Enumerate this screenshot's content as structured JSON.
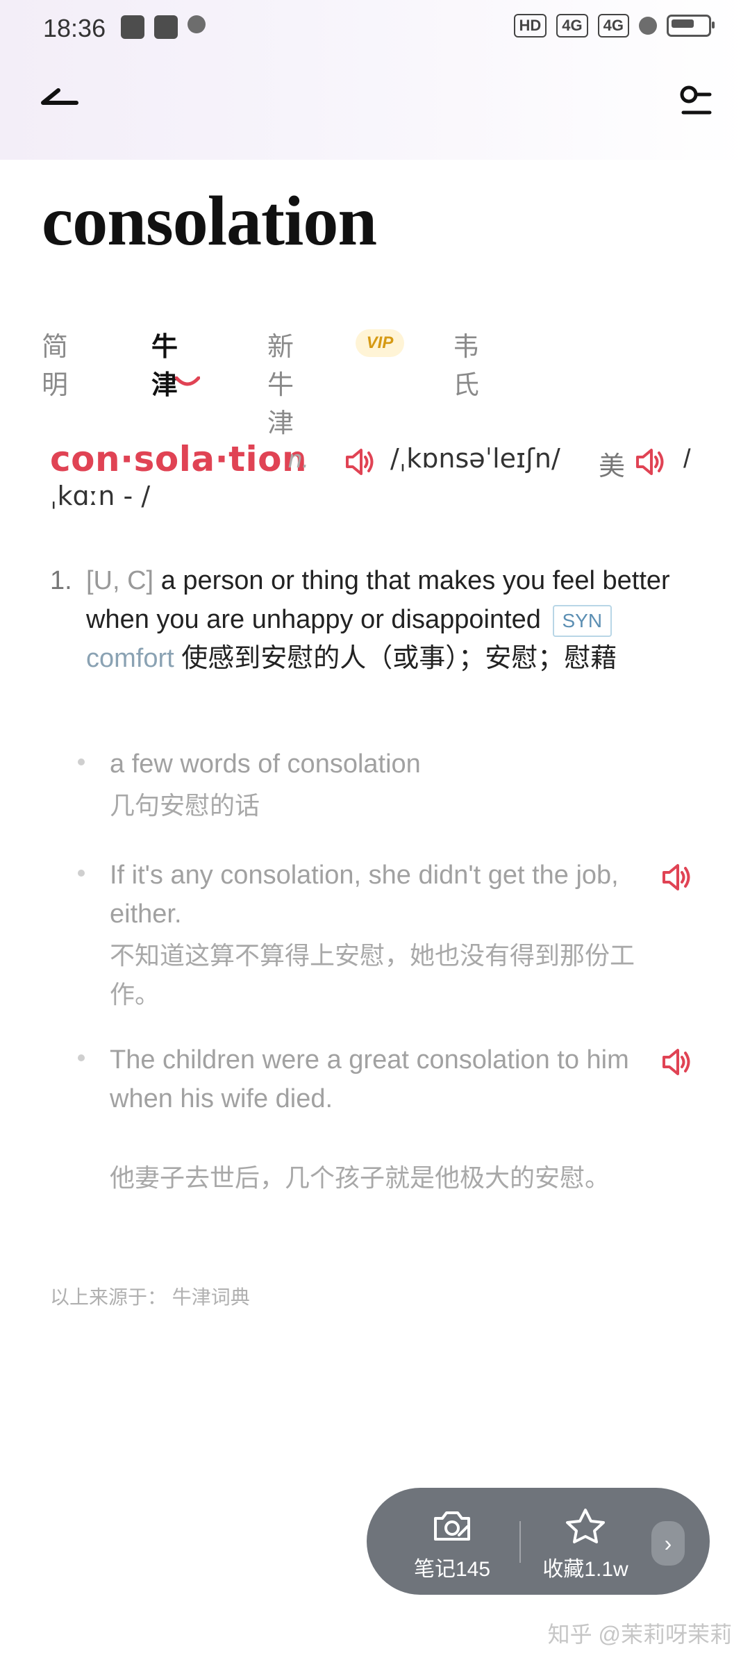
{
  "status": {
    "time": "18:36",
    "left_icons": [
      "image-app-icon",
      "chat-app-icon",
      "location-icon"
    ],
    "right_icons": [
      "hd-icon",
      "4g-signal-icon",
      "4g-signal-icon",
      "wifi-icon",
      "battery-icon"
    ]
  },
  "header": {
    "back_label": "",
    "settings_label": ""
  },
  "word": "consolation",
  "tabs": [
    {
      "label": "简明"
    },
    {
      "label": "牛津"
    },
    {
      "label": "新牛津"
    },
    {
      "label": "韦氏"
    }
  ],
  "vip_badge": "VIP",
  "entry": {
    "syllables": "con·sola·tion",
    "pos": "n.",
    "pron_uk": "/ˌkɒnsəˈleɪʃn/",
    "us_label": "美",
    "us_slash": "/",
    "pron_us": "ˌkɑːn - /"
  },
  "definition": {
    "number": "1.",
    "grammar": "[U, C]",
    "text": "a person or thing that makes you feel better when you are unhappy or disappointed",
    "syn_label": "SYN",
    "syn_word": "comfort",
    "chinese": "使感到安慰的人（或事）；安慰；慰藉"
  },
  "examples": [
    {
      "en": "a few words of consolation",
      "cn": "几句安慰的话",
      "has_audio": false
    },
    {
      "en": "If it's any consolation, she didn't get the job, either.",
      "cn": "不知道这算不算得上安慰，她也没有得到那份工作。",
      "has_audio": true
    },
    {
      "en": "The children were a great consolation to him when his wife died.",
      "cn": "他妻子去世后，几个孩子就是他极大的安慰。",
      "has_audio": true
    }
  ],
  "source": "以上来源于：  牛津词典",
  "bottom_bar": {
    "note_label": "笔记145",
    "fav_label": "收藏1.1w",
    "more_label": "›"
  },
  "watermark": "知乎 @茉莉呀茉莉",
  "colors": {
    "accent": "#e04354",
    "syn_blue": "#5c8fb3",
    "bottom_bar": "#6f747b"
  }
}
